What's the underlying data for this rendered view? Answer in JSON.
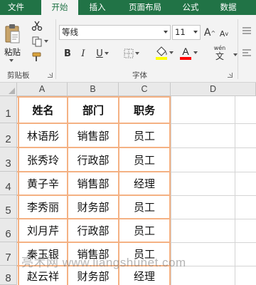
{
  "tabs": [
    {
      "label": "文件",
      "active": false
    },
    {
      "label": "开始",
      "active": true
    },
    {
      "label": "插入",
      "active": false
    },
    {
      "label": "页面布局",
      "active": false
    },
    {
      "label": "公式",
      "active": false
    },
    {
      "label": "数据",
      "active": false
    }
  ],
  "ribbon": {
    "clipboard": {
      "label": "剪贴板",
      "paste_label": "粘贴"
    },
    "font": {
      "label": "字体",
      "font_name": "等线",
      "font_size": "11",
      "bold": "B",
      "italic": "I",
      "underline": "U",
      "grow": "A",
      "shrink": "A",
      "phonetic_top": "wén",
      "phonetic_bottom": "文"
    }
  },
  "colors": {
    "accent": "#217346",
    "table_border": "#f4b183",
    "fill_highlight": "#ffff00",
    "font_color": "#ff0000"
  },
  "sheet": {
    "columns": [
      "A",
      "B",
      "C",
      "D"
    ],
    "rows": [
      "1",
      "2",
      "3",
      "4",
      "5",
      "6",
      "7",
      "8"
    ],
    "table": {
      "header": [
        "姓名",
        "部门",
        "职务"
      ],
      "body": [
        [
          "林语彤",
          "销售部",
          "员工"
        ],
        [
          "张秀玲",
          "行政部",
          "员工"
        ],
        [
          "黄子辛",
          "销售部",
          "经理"
        ],
        [
          "李秀丽",
          "财务部",
          "员工"
        ],
        [
          "刘月芹",
          "行政部",
          "员工"
        ],
        [
          "秦玉银",
          "销售部",
          "员工"
        ],
        [
          "赵云祥",
          "财务部",
          "经理"
        ]
      ]
    }
  },
  "watermark": {
    "text": "亮术网 www.liangshunet.com"
  }
}
